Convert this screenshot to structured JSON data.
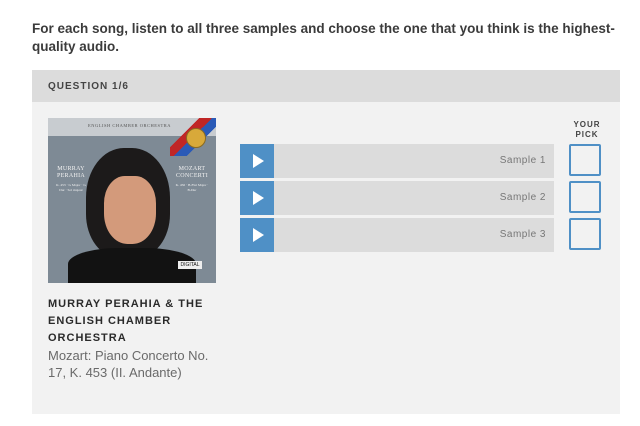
{
  "instructions": "For each song, listen to all three samples and choose the one that you think is the highest-quality audio.",
  "question": {
    "label": "QUESTION 1/6"
  },
  "album": {
    "cover_top_text": "ENGLISH CHAMBER ORCHESTRA",
    "cover_left_name": "MURRAY PERAHIA",
    "cover_left_small": "K. 453 · G Major · G Dur · Sol majeur",
    "cover_right_name": "MOZART CONCERTI",
    "cover_right_small": "K. 456 · B-Flat Major · B-Dur",
    "cover_cd": "DIGITAL"
  },
  "track": {
    "artist": "MURRAY PERAHIA & THE ENGLISH CHAMBER ORCHESTRA",
    "title": "Mozart: Piano Concerto No. 17, K. 453 (II. Andante)"
  },
  "pick_header": "YOUR PICK",
  "samples": [
    {
      "label": "Sample 1"
    },
    {
      "label": "Sample 2"
    },
    {
      "label": "Sample 3"
    }
  ],
  "colors": {
    "accent": "#4f90c6",
    "panel_bg": "#f2f2f2",
    "header_bg": "#dcdcdc"
  },
  "icons": {
    "play": "play-icon"
  }
}
